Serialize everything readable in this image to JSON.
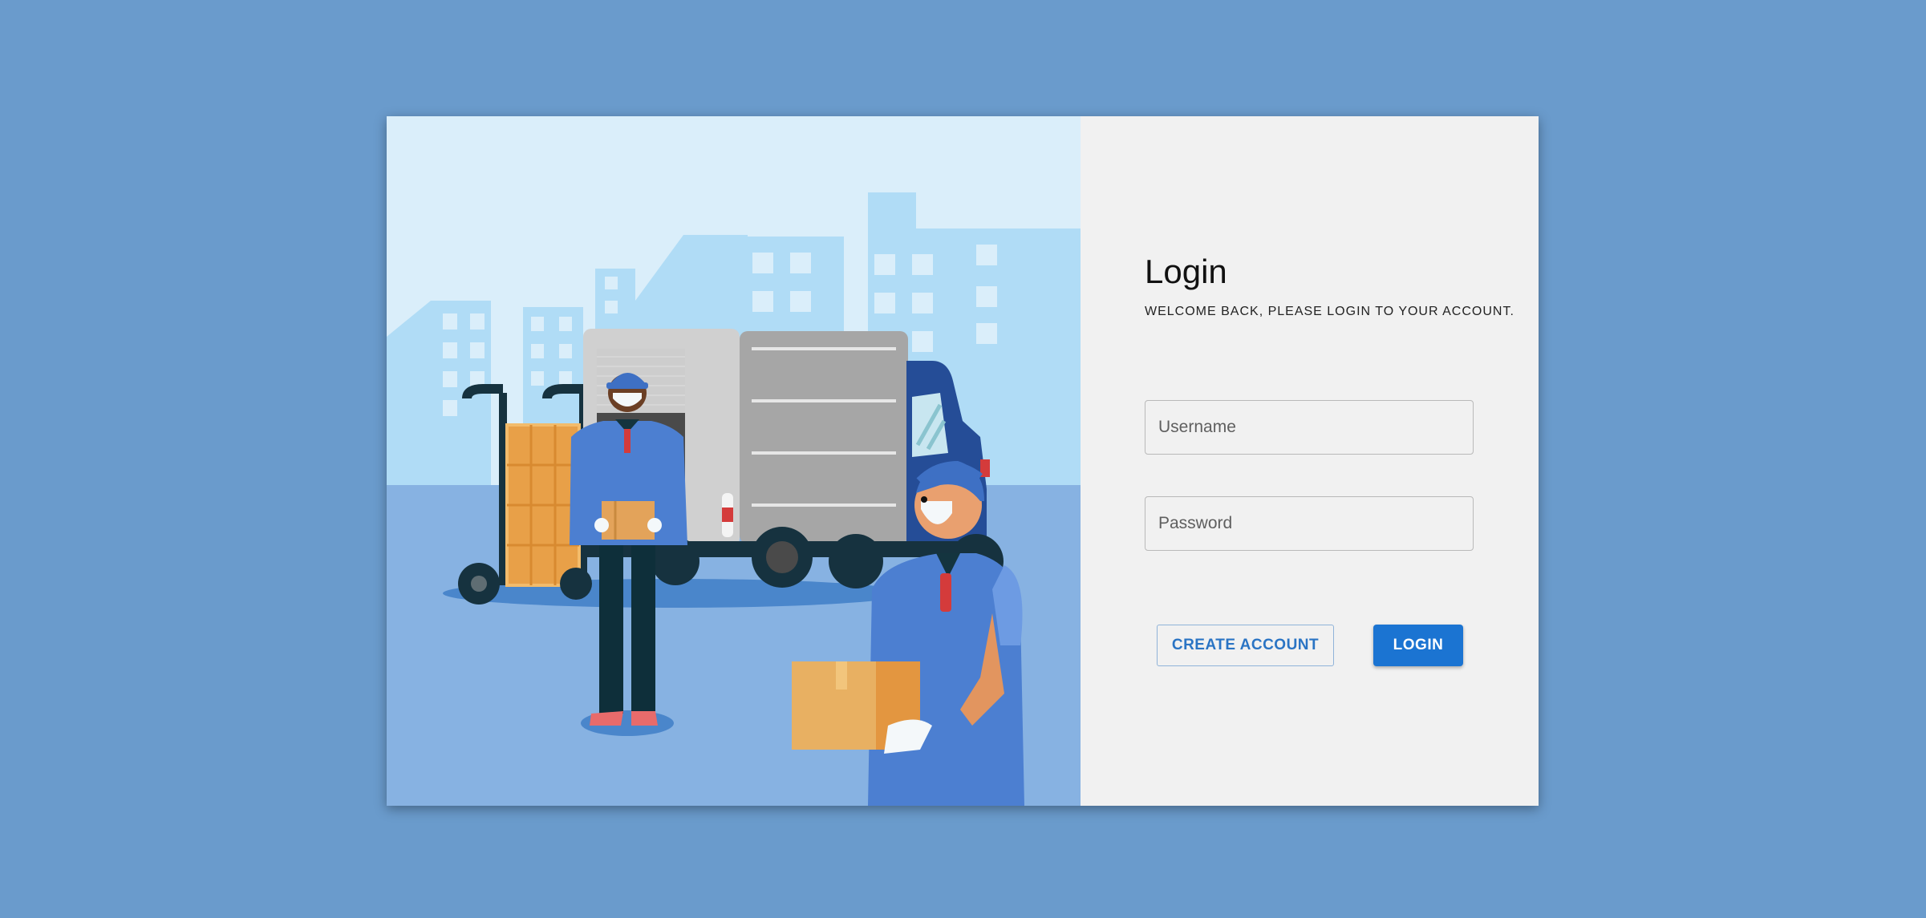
{
  "login": {
    "title": "Login",
    "subtitle": "WELCOME BACK, PLEASE LOGIN TO YOUR ACCOUNT.",
    "username_placeholder": "Username",
    "username_value": "",
    "password_placeholder": "Password",
    "password_value": "",
    "create_account_label": "CREATE ACCOUNT",
    "login_label": "LOGIN"
  },
  "colors": {
    "page_background": "#6a9bcc",
    "panel_background": "#f1f1f1",
    "primary_button": "#1b74d2",
    "outline_button_text": "#2a74c4"
  },
  "illustration": {
    "subject": "delivery-workers-with-truck"
  }
}
